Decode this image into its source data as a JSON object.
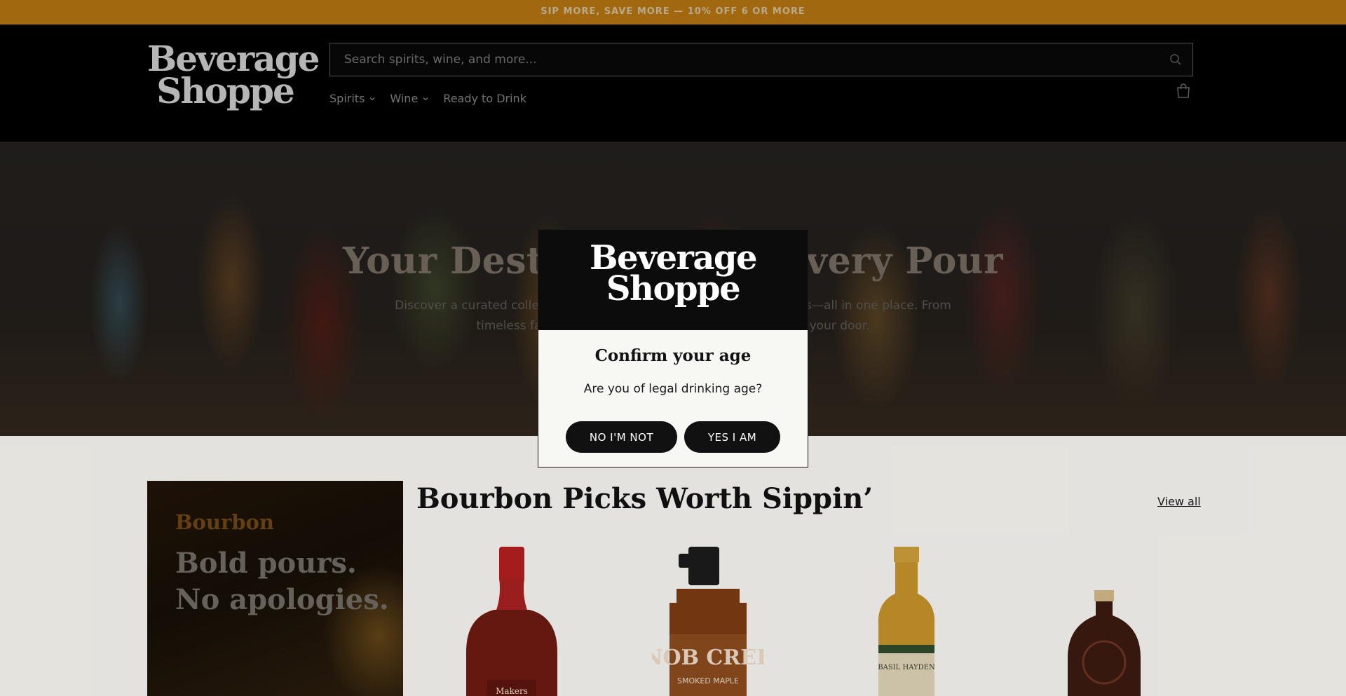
{
  "announcement": {
    "text": "SIP MORE, SAVE MORE — 10% OFF 6 OR MORE"
  },
  "header": {
    "logo": {
      "line1": "Beverage",
      "line2": "Shoppe"
    },
    "search": {
      "placeholder": "Search spirits, wine, and more..."
    },
    "nav": [
      {
        "label": "Spirits",
        "has_dropdown": true
      },
      {
        "label": "Wine",
        "has_dropdown": true
      },
      {
        "label": "Ready to Drink",
        "has_dropdown": false
      }
    ],
    "icons": {
      "search": "search-icon",
      "cart": "cart-icon"
    }
  },
  "hero": {
    "title": "Your Destination for Every Pour",
    "subtitle": "Discover a curated collection of spirits, wine, and alcoholic beverages—all in one place. From timeless favorites to new finds, we bring every taste to your door."
  },
  "promo": {
    "eyebrow": "Bourbon",
    "headline_line1": "Bold pours.",
    "headline_line2": "No apologies."
  },
  "section": {
    "title": "Bourbon Picks Worth Sippin’",
    "view_all": "View all",
    "products": [
      {
        "name": "Maker's Mark bottle",
        "label_text": "Makers"
      },
      {
        "name": "Knob Creek Smoked Maple bottle",
        "label_text": "KNOB CREEK",
        "sub_label": "SMOKED MAPLE"
      },
      {
        "name": "Basil Hayden bottle",
        "label_text": "BASIL HAYDEN"
      },
      {
        "name": "Bulleit-style dark bottle",
        "label_text": ""
      }
    ]
  },
  "age_modal": {
    "logo": {
      "line1": "Beverage",
      "line2": "Shoppe"
    },
    "title": "Confirm your age",
    "question": "Are you of legal drinking age?",
    "no_label": "NO I'M NOT",
    "yes_label": "YES I AM"
  },
  "colors": {
    "announcement_bg": "#d98b14",
    "header_bg": "#000000",
    "modal_bg": "#f7f7f3",
    "button_bg": "#111111",
    "promo_accent": "#6b4511"
  }
}
